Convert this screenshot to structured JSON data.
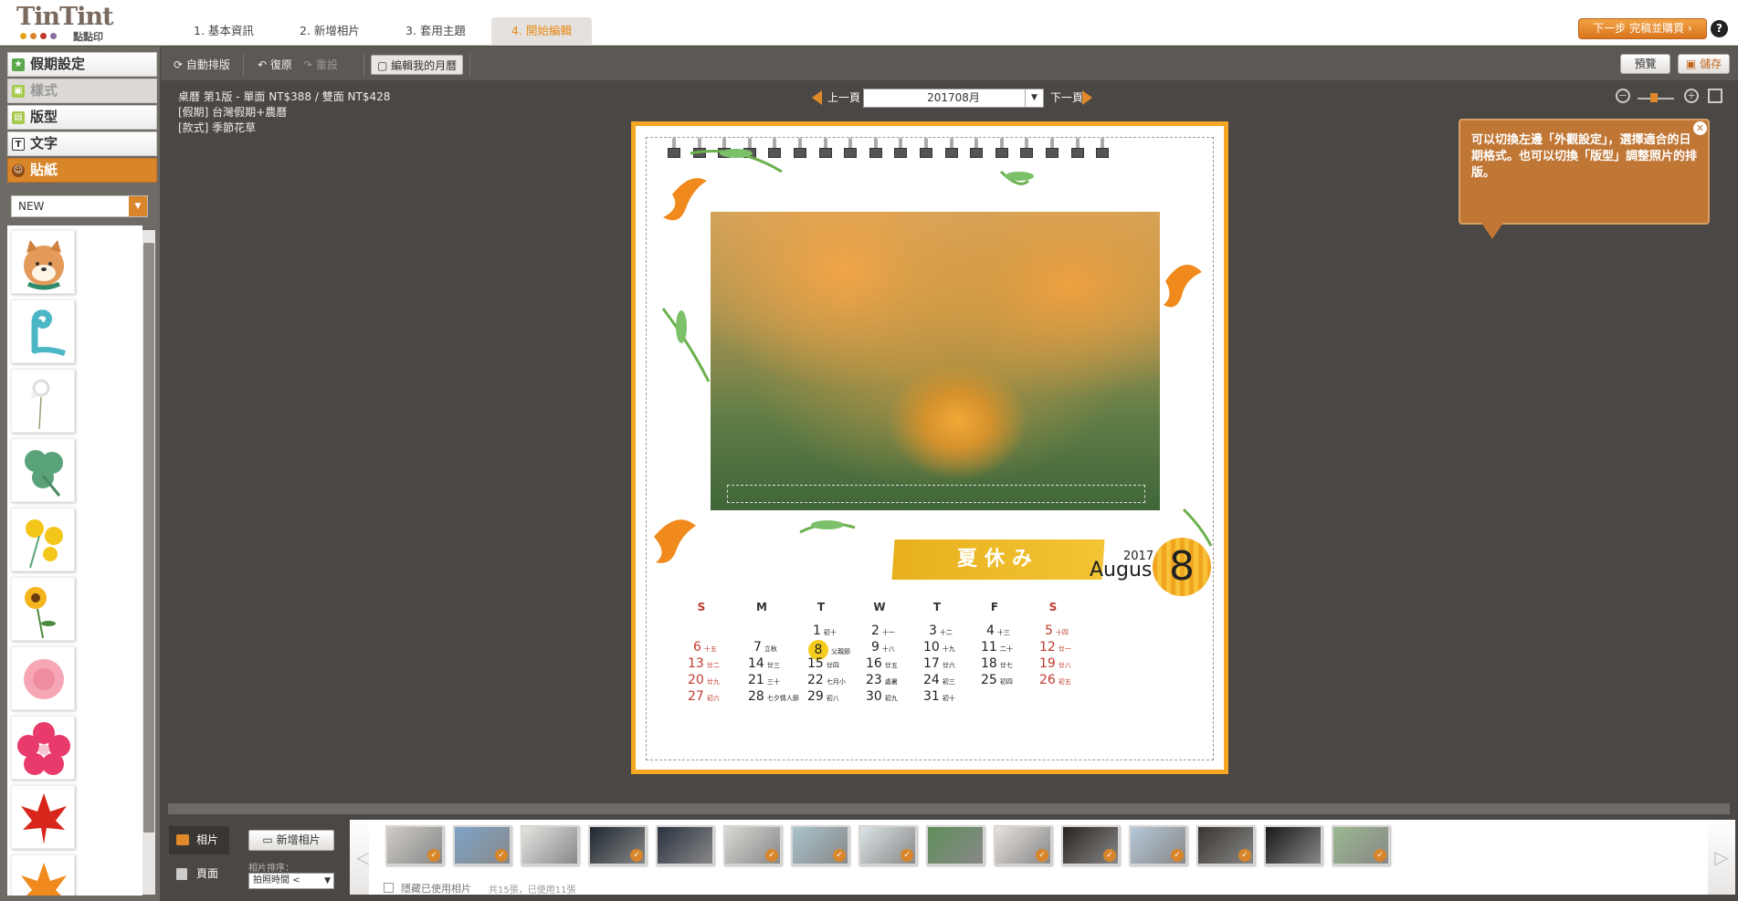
{
  "header": {
    "logo_name": "TinTint",
    "logo_sub": "點點印",
    "steps": [
      "1. 基本資訊",
      "2. 新增相片",
      "3. 套用主題",
      "4. 開始編輯"
    ],
    "active_step": 3,
    "next_label": "下一步 完稿並購買 ›",
    "help_label": "?"
  },
  "left_panel": {
    "categories": [
      {
        "label": "假期設定",
        "icon": "star-icon"
      },
      {
        "label": "樣式",
        "icon": "style-icon"
      },
      {
        "label": "版型",
        "icon": "layout-icon"
      },
      {
        "label": "文字",
        "icon": "text-icon"
      },
      {
        "label": "貼紙",
        "icon": "sticker-icon"
      }
    ],
    "sticker_filter": "NEW",
    "stickers": [
      "shiba-dog",
      "teal-swirl",
      "white-flower",
      "green-clover",
      "yellow-flower",
      "sunflower",
      "pink-carnation",
      "pink-blossom",
      "red-maple-leaf",
      "orange-maple-leaf"
    ]
  },
  "toolbar": {
    "auto_layout": "自動排版",
    "undo": "復原",
    "redo": "重設",
    "edit_calendar": "編輯我的月曆",
    "preview": "預覽",
    "save": "儲存"
  },
  "info": {
    "line1": "桌曆 第1版 - 單面  NT$388 / 雙面 NT$428",
    "line2": "[假期] 台灣假期+農曆",
    "line3": "[款式] 季節花草"
  },
  "pager": {
    "prev": "上一頁",
    "next": "下一頁",
    "month": "201708月"
  },
  "tooltip": {
    "text": "可以切換左邊「外觀設定」，選擇適合的日期格式。也可以切換「版型」調整照片的排版。"
  },
  "calendar": {
    "title": "夏休み",
    "year": "2017",
    "month_name": "August",
    "month_num": "8",
    "dow": [
      "S",
      "M",
      "T",
      "W",
      "T",
      "F",
      "S"
    ],
    "weeks": [
      [
        null,
        null,
        {
          "d": "1",
          "l": "初十"
        },
        {
          "d": "2",
          "l": "十一"
        },
        {
          "d": "3",
          "l": "十二"
        },
        {
          "d": "4",
          "l": "十三"
        },
        {
          "d": "5",
          "l": "十四"
        }
      ],
      [
        {
          "d": "6",
          "l": "十五"
        },
        {
          "d": "7",
          "l": "立秋"
        },
        {
          "d": "8",
          "l": "父親節"
        },
        {
          "d": "9",
          "l": "十八"
        },
        {
          "d": "10",
          "l": "十九"
        },
        {
          "d": "11",
          "l": "二十"
        },
        {
          "d": "12",
          "l": "廿一"
        }
      ],
      [
        {
          "d": "13",
          "l": "廿二"
        },
        {
          "d": "14",
          "l": "廿三"
        },
        {
          "d": "15",
          "l": "廿四"
        },
        {
          "d": "16",
          "l": "廿五"
        },
        {
          "d": "17",
          "l": "廿六"
        },
        {
          "d": "18",
          "l": "廿七"
        },
        {
          "d": "19",
          "l": "廿八"
        }
      ],
      [
        {
          "d": "20",
          "l": "廿九"
        },
        {
          "d": "21",
          "l": "三十"
        },
        {
          "d": "22",
          "l": "七月小"
        },
        {
          "d": "23",
          "l": "處暑"
        },
        {
          "d": "24",
          "l": "初三"
        },
        {
          "d": "25",
          "l": "初四"
        },
        {
          "d": "26",
          "l": "初五"
        }
      ],
      [
        {
          "d": "27",
          "l": "初六"
        },
        {
          "d": "28",
          "l": "七夕情人節"
        },
        {
          "d": "29",
          "l": "初八"
        },
        {
          "d": "30",
          "l": "初九"
        },
        {
          "d": "31",
          "l": "初十"
        },
        null,
        null
      ]
    ],
    "highlight_day": "8"
  },
  "bottom": {
    "tab_photos": "相片",
    "tab_pages": "頁面",
    "add_photo": "新增相片",
    "sort_label": "相片排序：",
    "sort_value": "拍照時間 <",
    "hide_used": "隱藏已使用相片",
    "count": "共15張，已使用11張",
    "thumb_colors": [
      "#cfcbc6",
      "#7ea4c9",
      "#e6e4e1",
      "#1e2731",
      "#2a3240",
      "#dad8d4",
      "#a9c3cc",
      "#dbe3e6",
      "#5f8f5a",
      "#e6e1dc",
      "#2a2420",
      "#b5c8d8",
      "#3a3530",
      "#1a1816",
      "#9bb890"
    ],
    "thumb_checked": [
      true,
      true,
      false,
      true,
      false,
      true,
      true,
      true,
      false,
      true,
      true,
      true,
      true,
      false,
      true
    ]
  },
  "colors": {
    "accent": "#e0892a",
    "page_border": "#f5a623",
    "holiday_red": "#c0392b"
  }
}
